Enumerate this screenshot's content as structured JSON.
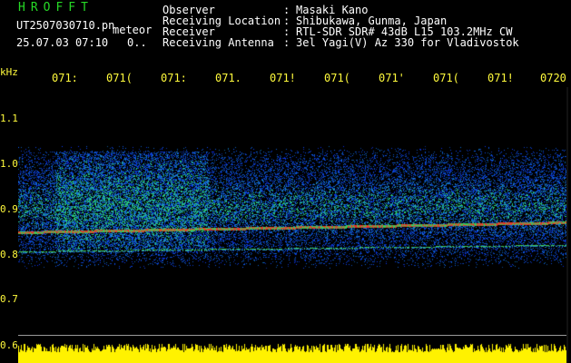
{
  "header": {
    "brand": "HROFFT",
    "file": "UT2507030710.pn",
    "mode": "meteor",
    "stamp": "25.07.03 07:10",
    "count": "0.."
  },
  "info": {
    "rows": [
      {
        "label": "Observer",
        "value": "Masaki Kano"
      },
      {
        "label": "Receiving Location",
        "value": "Shibukawa, Gunma, Japan"
      },
      {
        "label": "Receiver",
        "value": "RTL-SDR SDR# 43dB L15 103.2MHz CW"
      },
      {
        "label": "Receiving Antenna",
        "value": "3el Yagi(V) Az 330 for Vladivostok"
      }
    ],
    "separator": ":"
  },
  "axis": {
    "unit": "kHz",
    "y_ticks": [
      "1.1",
      "1.0",
      "0.9",
      "0.8",
      "0.7",
      "0.6"
    ],
    "time_labels": [
      "071:",
      "071(",
      "071:",
      "071.",
      "071!",
      "071(",
      "071'",
      "071(",
      "071!",
      "0720"
    ]
  },
  "colors": {
    "label_yellow": "#fffa3c",
    "brand_green": "#26d926",
    "background": "#000000"
  }
}
